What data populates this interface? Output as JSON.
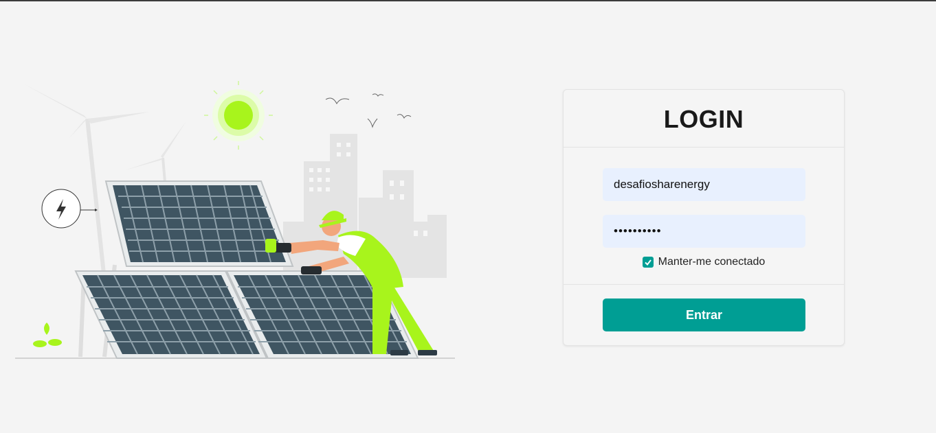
{
  "login": {
    "title": "LOGIN",
    "username_value": "desafiosharenergy",
    "password_value": "••••••••••",
    "remember_label": "Manter-me conectado",
    "remember_checked": true,
    "submit_label": "Entrar"
  },
  "colors": {
    "accent": "#009e94",
    "input_bg": "#e8f0fe",
    "page_bg": "#f4f4f4",
    "illustration_green": "#a8f41c"
  },
  "icons": [
    "lightning-icon",
    "check-icon",
    "sun-icon"
  ]
}
